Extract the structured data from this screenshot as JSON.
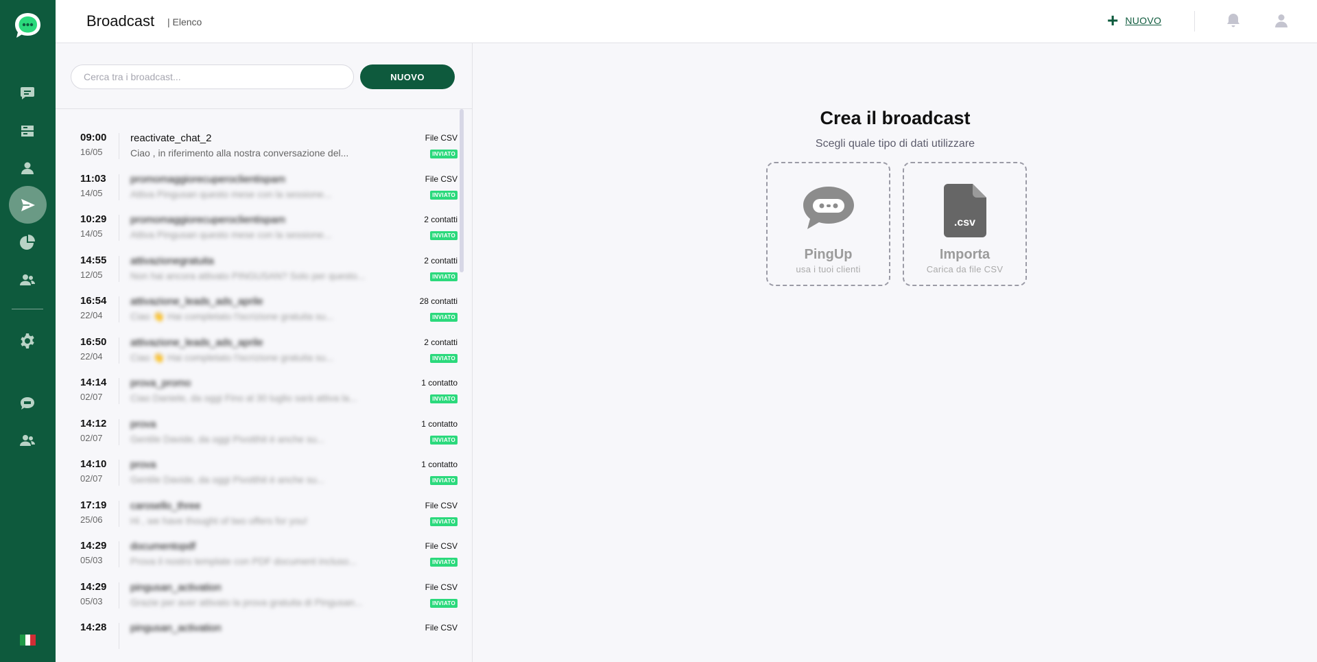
{
  "header": {
    "title": "Broadcast",
    "crumb": "| Elenco",
    "new_label": "NUOVO"
  },
  "sidebar": {
    "items": [
      {
        "name": "chat",
        "icon": "chat-icon"
      },
      {
        "name": "inbox",
        "icon": "inbox-icon"
      },
      {
        "name": "contacts",
        "icon": "user-icon"
      },
      {
        "name": "broadcast",
        "icon": "send-icon",
        "active": true
      },
      {
        "name": "stats",
        "icon": "pie-chart-icon"
      },
      {
        "name": "team",
        "icon": "users-icon"
      },
      {
        "name": "settings",
        "icon": "gear-icon"
      },
      {
        "name": "bot",
        "icon": "bot-icon"
      },
      {
        "name": "agents",
        "icon": "users-icon"
      }
    ],
    "language": "it"
  },
  "list": {
    "search_placeholder": "Cerca tra i broadcast...",
    "new_button": "NUOVO",
    "rows": [
      {
        "time": "09:00",
        "date": "16/05",
        "name": "reactivate_chat_2",
        "preview": "Ciao , in riferimento alla nostra conversazione del...",
        "count": "File CSV",
        "status": "INVIATO",
        "blurred": false
      },
      {
        "time": "11:03",
        "date": "14/05",
        "name": "promomaggiorecuperoclientispam",
        "preview": "Attiva Pingusan questo mese con la sessione...",
        "count": "File CSV",
        "status": "INVIATO",
        "blurred": true
      },
      {
        "time": "10:29",
        "date": "14/05",
        "name": "promomaggiorecuperoclientispam",
        "preview": "Attiva Pingusan questo mese con la sessione...",
        "count": "2 contatti",
        "status": "INVIATO",
        "blurred": true
      },
      {
        "time": "14:55",
        "date": "12/05",
        "name": "attivazionegratuita",
        "preview": "Non hai ancora attivato PINGUSAN? Solo per questo...",
        "count": "2 contatti",
        "status": "INVIATO",
        "blurred": true
      },
      {
        "time": "16:54",
        "date": "22/04",
        "name": "attivazione_leads_ads_aprile",
        "preview": "Ciao 👋 Hai completato l'iscrizione gratuita su...",
        "count": "28 contatti",
        "status": "INVIATO",
        "blurred": true
      },
      {
        "time": "16:50",
        "date": "22/04",
        "name": "attivazione_leads_ads_aprile",
        "preview": "Ciao 👋 Hai completato l'iscrizione gratuita su...",
        "count": "2 contatti",
        "status": "INVIATO",
        "blurred": true
      },
      {
        "time": "14:14",
        "date": "02/07",
        "name": "prova_promo",
        "preview": "Ciao Daniele, da oggi Fino al 30 luglio sarà attiva la...",
        "count": "1 contatto",
        "status": "INVIATO",
        "blurred": true
      },
      {
        "time": "14:12",
        "date": "02/07",
        "name": "prova",
        "preview": "Gentile Davide, da oggi Pivotthit è anche su...",
        "count": "1 contatto",
        "status": "INVIATO",
        "blurred": true
      },
      {
        "time": "14:10",
        "date": "02/07",
        "name": "prova",
        "preview": "Gentile Davide, da oggi Pivotthit è anche su...",
        "count": "1 contatto",
        "status": "INVIATO",
        "blurred": true
      },
      {
        "time": "17:19",
        "date": "25/06",
        "name": "carosello_three",
        "preview": "Hi , we have thought of two offers for you!",
        "count": "File CSV",
        "status": "INVIATO",
        "blurred": true
      },
      {
        "time": "14:29",
        "date": "05/03",
        "name": "documentopdf",
        "preview": "Prova il nostro template con PDF document incluso...",
        "count": "File CSV",
        "status": "INVIATO",
        "blurred": true
      },
      {
        "time": "14:29",
        "date": "05/03",
        "name": "pingusan_activation",
        "preview": "Grazie per aver attivato la prova gratuita di Pingusan...",
        "count": "File CSV",
        "status": "INVIATO",
        "blurred": true
      },
      {
        "time": "14:28",
        "date": "",
        "name": "pingusan_activation",
        "preview": "",
        "count": "File CSV",
        "status": "",
        "blurred": true
      }
    ]
  },
  "main": {
    "title": "Crea il broadcast",
    "subtitle": "Scegli quale tipo di dati utilizzare",
    "cards": [
      {
        "title": "PingUp",
        "subtitle": "usa i tuoi clienti",
        "icon": "chat-bubble-icon"
      },
      {
        "title": "Importa",
        "subtitle": "Carica da file CSV",
        "icon": "csv-file-icon",
        "icon_label": ".csv"
      }
    ]
  },
  "colors": {
    "brand": "#0e5a3d",
    "badge": "#2bd97c",
    "background": "#f7f7fa"
  }
}
